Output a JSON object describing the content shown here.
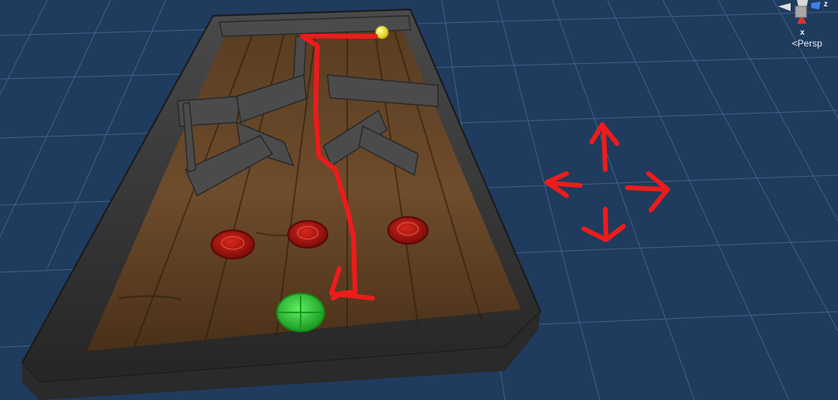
{
  "app": {
    "view": "scene-view",
    "projection_label": "Persp"
  },
  "gizmo": {
    "axes": [
      {
        "name": "x",
        "label": "x",
        "color": "#d8342b"
      },
      {
        "name": "z",
        "label": "z",
        "color": "#3f7ff0"
      },
      {
        "name": "y",
        "label": "",
        "color": "#c8c8c8"
      }
    ]
  },
  "colors": {
    "background": "#1f3b5e",
    "grid": "#5f7fa6",
    "board_wood": "#6b4a2a",
    "frame": "#3a3a3a",
    "ball": "#f2e51a",
    "red_target": "#b81510",
    "green_goal": "#2fd43a",
    "path_annotation": "#ee1b1b"
  },
  "scene": {
    "board": "wooden-maze-board",
    "ball": "yellow-ball",
    "red_targets": 3,
    "green_goal": 1,
    "annotation": "red-drawn-path-and-move-arrows"
  }
}
